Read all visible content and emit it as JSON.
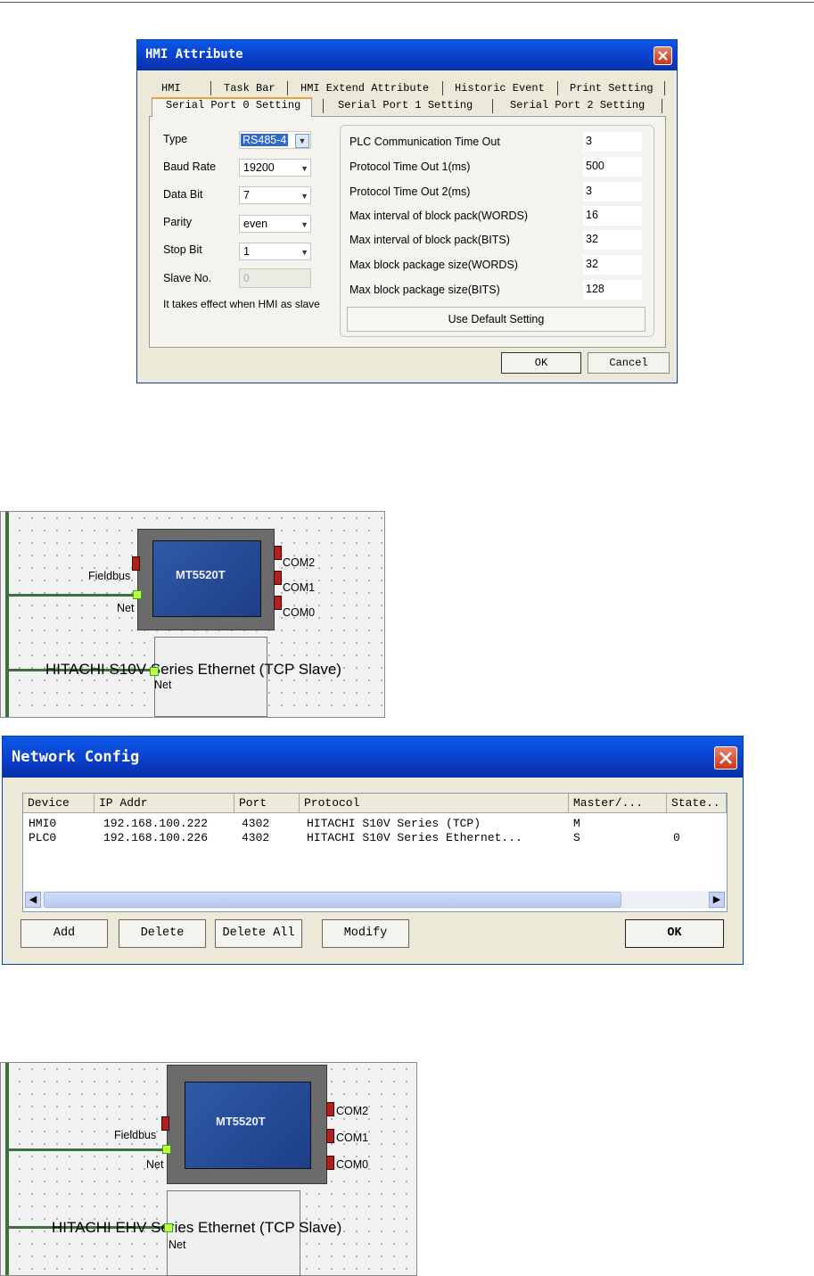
{
  "hmi_dialog": {
    "title": "HMI Attribute",
    "tabs_row1": [
      "HMI",
      "Task Bar",
      "HMI Extend Attribute",
      "Historic Event",
      "Print Setting"
    ],
    "tabs_row2": [
      "Serial Port 0 Setting",
      "Serial Port 1 Setting",
      "Serial Port 2 Setting"
    ],
    "fields": [
      {
        "label": "Type",
        "value": "RS485-4"
      },
      {
        "label": "Baud Rate",
        "value": "19200"
      },
      {
        "label": "Data Bit",
        "value": "7"
      },
      {
        "label": "Parity",
        "value": "even"
      },
      {
        "label": "Stop Bit",
        "value": "1"
      }
    ],
    "slave_label": "Slave No.",
    "slave_value": "0",
    "note": "It takes effect when HMI as slave",
    "params": [
      {
        "label": "PLC Communication Time Out",
        "value": "3"
      },
      {
        "label": "Protocol Time Out 1(ms)",
        "value": "500"
      },
      {
        "label": "Protocol Time Out 2(ms)",
        "value": "3"
      },
      {
        "label": "Max interval of block pack(WORDS)",
        "value": "16"
      },
      {
        "label": "Max interval of block pack(BITS)",
        "value": "32"
      },
      {
        "label": "Max block package size(WORDS)",
        "value": "32"
      },
      {
        "label": "Max block package size(BITS)",
        "value": "128"
      }
    ],
    "default_button": "Use Default Setting",
    "ok": "OK",
    "cancel": "Cancel"
  },
  "diagram1": {
    "model": "MT5520T",
    "fieldbus": "Fieldbus",
    "net": "Net",
    "com2": "COM2",
    "com1": "COM1",
    "com0": "COM0",
    "device_label": "HITACHI S10V Series Ethernet (TCP Slave)",
    "plc_net": "Net"
  },
  "network_dialog": {
    "title": "Network Config",
    "columns": [
      "Device",
      "IP Addr",
      "Port",
      "Protocol",
      "Master/...",
      "State.."
    ],
    "rows": [
      {
        "device": "HMI0",
        "ip": "192.168.100.222",
        "port": "4302",
        "protocol": "HITACHI S10V Series (TCP)",
        "master": "M",
        "state": ""
      },
      {
        "device": "PLC0",
        "ip": "192.168.100.226",
        "port": "4302",
        "protocol": "HITACHI S10V Series Ethernet...",
        "master": "S",
        "state": "0"
      }
    ],
    "buttons": {
      "add": "Add",
      "delete": "Delete",
      "delete_all": "Delete All",
      "modify": "Modify",
      "ok": "OK"
    }
  },
  "diagram2": {
    "model": "MT5520T",
    "fieldbus": "Fieldbus",
    "net": "Net",
    "com2": "COM2",
    "com1": "COM1",
    "com0": "COM0",
    "device_label": "HITACHI EHV Series Ethernet (TCP Slave)",
    "plc_net": "Net"
  }
}
